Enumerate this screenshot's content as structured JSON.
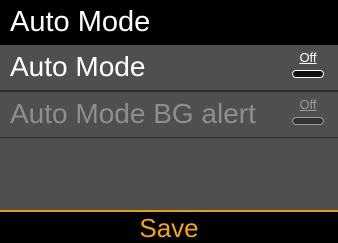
{
  "header": {
    "title": "Auto Mode"
  },
  "settings": [
    {
      "label": "Auto Mode",
      "toggle_text": "Off",
      "enabled": true
    },
    {
      "label": "Auto Mode BG alert",
      "toggle_text": "Off",
      "enabled": false
    }
  ],
  "footer": {
    "save_label": "Save"
  },
  "colors": {
    "title_bar": "#000000",
    "row_background": "#4f4f4f",
    "enabled_text": "#ffffff",
    "disabled_text": "#8e8e8e",
    "action_text": "#f0a800",
    "action_border": "#e0a000"
  }
}
